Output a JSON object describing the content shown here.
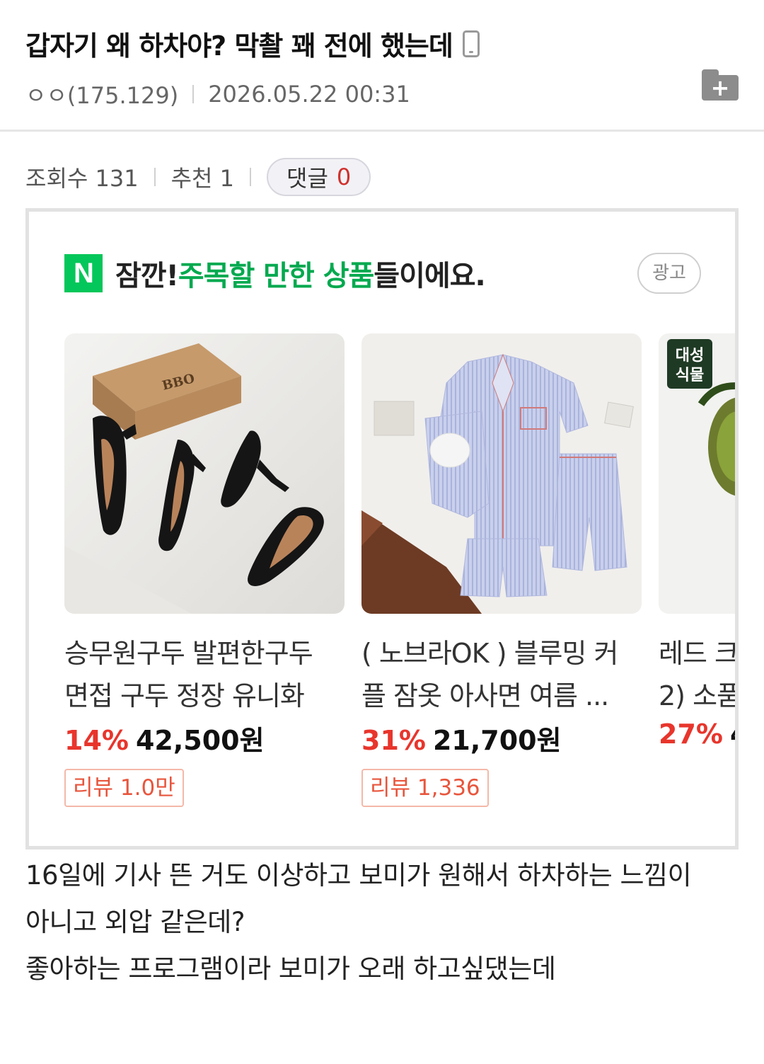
{
  "post": {
    "title": "갑자기 왜 하차야? 막촬 꽤 전에 했는데",
    "author": "ㅇㅇ(175.129)",
    "date": "2026.05.22 00:31"
  },
  "stats": {
    "views_label": "조회수 131",
    "recommend_label": "추천 1",
    "comments_label": "댓글",
    "comments_count": "0"
  },
  "ad": {
    "logo": "N",
    "headline_prefix": "잠깐! ",
    "headline_highlight": "주목할 만한 상품",
    "headline_suffix": "들이에요.",
    "badge": "광고",
    "products": [
      {
        "name_line1": "승무원구두 발편한구두",
        "name_line2": "면접 구두 정장 유니화",
        "discount": "14%",
        "price": "42,500원",
        "review": "리뷰 1.0만"
      },
      {
        "name_line1": "( 노브라OK ) 블루밍 커",
        "name_line2": "플 잠옷 아사면 여름 ...",
        "discount": "31%",
        "price": "21,700원",
        "review": "리뷰 1,336"
      },
      {
        "name_line1": "레드 크",
        "name_line2": "2) 소품",
        "discount": "27%",
        "price": "4",
        "review": "",
        "img_text_1": "대성",
        "img_text_2": "식물"
      }
    ],
    "brand_box_text": "BBO"
  },
  "body": {
    "line1": "16일에 기사 뜬 거도 이상하고 보미가 원해서 하차하는 느낌이",
    "line2": "아니고 외압 같은데?",
    "line3": "좋아하는 프로그램이라 보미가 오래 하고싶댔는데"
  },
  "colors": {
    "naver_green": "#03c75a",
    "highlight_green": "#03a94f",
    "discount_red": "#e8352c",
    "comment_count_red": "#d0312d"
  }
}
